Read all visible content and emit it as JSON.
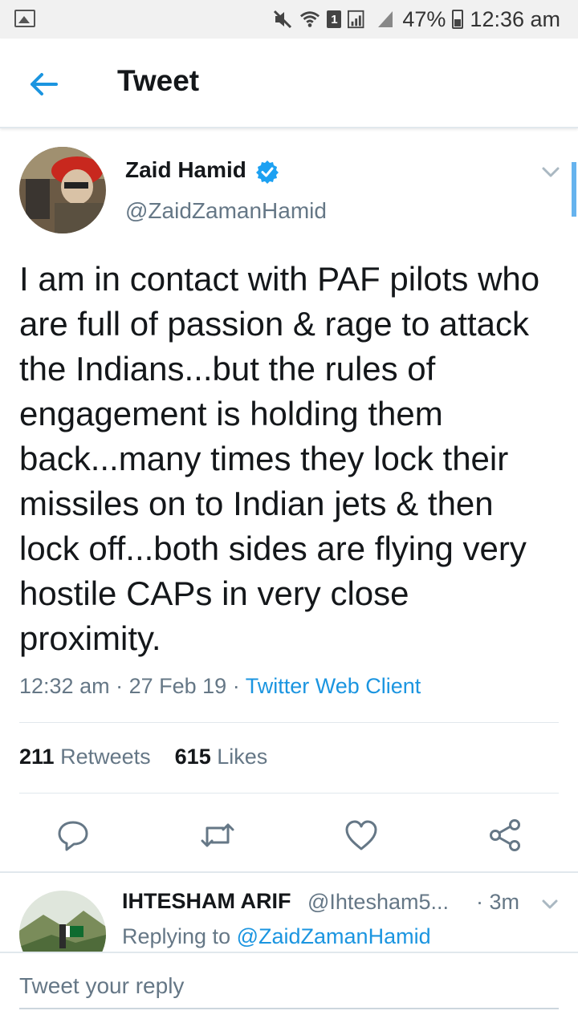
{
  "status_bar": {
    "battery": "47%",
    "time": "12:36 am",
    "sim_badge": "1"
  },
  "header": {
    "title": "Tweet",
    "back_icon": "arrow-left-icon"
  },
  "tweet": {
    "author_name": "Zaid Hamid",
    "author_handle": "@ZaidZamanHamid",
    "verified": true,
    "text": "I am in contact with PAF pilots who are full of passion & rage to attack the Indians...but the rules of engagement is holding them back...many times they lock their missiles on to Indian jets & then lock off...both sides are flying very hostile CAPs in very close proximity.",
    "time": "12:32 am",
    "date": "27 Feb 19",
    "separator": "·",
    "client": "Twitter Web Client",
    "retweets_count": "211",
    "retweets_label": "Retweets",
    "likes_count": "615",
    "likes_label": "Likes"
  },
  "actions": {
    "reply_icon": "reply-icon",
    "retweet_icon": "retweet-icon",
    "like_icon": "heart-icon",
    "share_icon": "share-icon"
  },
  "reply": {
    "author_name": "IHTESHAM ARIF",
    "author_handle": "@Ihtesham5...",
    "time": "· 3m",
    "replying_prefix": "Replying to",
    "replying_to": "@ZaidZamanHamid"
  },
  "compose": {
    "placeholder": "Tweet your reply"
  },
  "colors": {
    "accent": "#1b95e0",
    "text": "#14171a",
    "secondary": "#657786",
    "divider": "#e1e8ed"
  }
}
